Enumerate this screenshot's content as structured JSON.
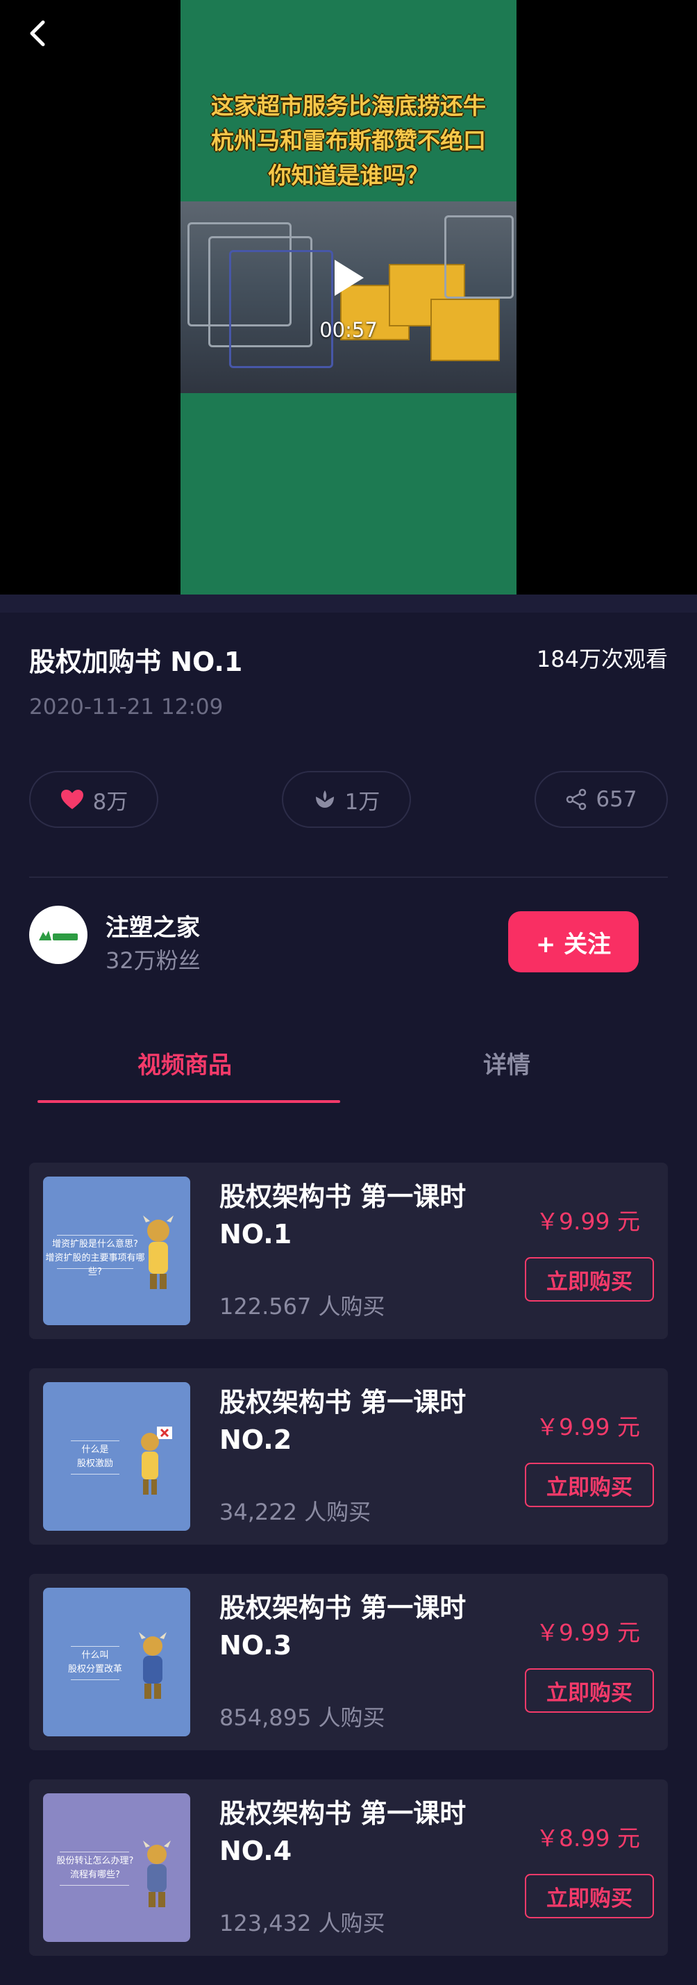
{
  "video": {
    "headline_lines": [
      "这家超市服务比海底捞还牛",
      "杭州马和雷布斯都赞不绝口",
      "你知道是谁吗？"
    ],
    "duration": "00:57"
  },
  "info": {
    "title": "股权加购书 NO.1",
    "views": "184万次观看",
    "date": "2020-11-21 12:09"
  },
  "actions": {
    "likes": "8万",
    "gifts": "1万",
    "shares": "657"
  },
  "author": {
    "name": "注塑之家",
    "fans": "32万粉丝",
    "follow_label": "+ 关注"
  },
  "tabs": {
    "products": "视频商品",
    "details": "详情"
  },
  "products": [
    {
      "name_line1": "股权架构书 第一课时",
      "name_line2": "NO.1",
      "price": "￥9.99 元",
      "buyers": "122.567 人购买",
      "buy_label": "立即购买",
      "thumb_lines": [
        "增资扩股是什么意思?",
        "增资扩股的主要事项有哪些?"
      ],
      "thumb_color": "#6b8fcf"
    },
    {
      "name_line1": "股权架构书 第一课时",
      "name_line2": "NO.2",
      "price": "￥9.99 元",
      "buyers": "34,222 人购买",
      "buy_label": "立即购买",
      "thumb_lines": [
        "什么是",
        "股权激励"
      ],
      "thumb_color": "#6b8fcf"
    },
    {
      "name_line1": "股权架构书 第一课时",
      "name_line2": "NO.3",
      "price": "￥9.99 元",
      "buyers": "854,895 人购买",
      "buy_label": "立即购买",
      "thumb_lines": [
        "什么叫",
        "股权分置改革"
      ],
      "thumb_color": "#6b8fcf"
    },
    {
      "name_line1": "股权架构书 第一课时",
      "name_line2": "NO.4",
      "price": "￥8.99 元",
      "buyers": "123,432 人购买",
      "buy_label": "立即购买",
      "thumb_lines": [
        "股份转让怎么办理?",
        "流程有哪些?"
      ],
      "thumb_color": "#8a87c4"
    }
  ],
  "colors": {
    "background": "#17172e",
    "accent": "#f53a6a",
    "card": "#232339",
    "video_bg": "#1d7a52"
  }
}
